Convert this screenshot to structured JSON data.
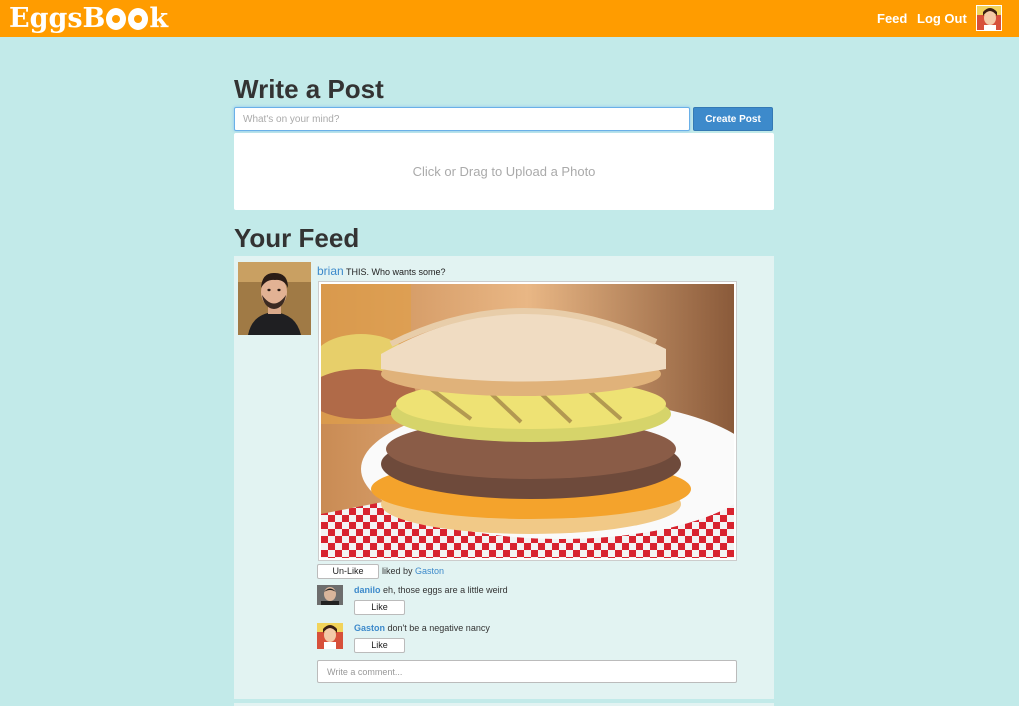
{
  "app": {
    "logo_text_before": "EggsB",
    "logo_text_after": "k"
  },
  "nav": {
    "feed_label": "Feed",
    "logout_label": "Log Out"
  },
  "compose": {
    "heading": "Write a Post",
    "placeholder": "What's on your mind?",
    "create_button": "Create Post",
    "upload_text": "Click or Drag to Upload a Photo"
  },
  "feed": {
    "heading": "Your Feed",
    "post": {
      "author": "brian",
      "text": "THIS. Who wants some?",
      "unlike_button": "Un-Like",
      "liked_by_prefix": "liked by",
      "liked_by_user": "Gaston",
      "comments": [
        {
          "user": "danilo",
          "text": "eh, those eggs are a little weird",
          "like_button": "Like"
        },
        {
          "user": "Gaston",
          "text": "don't be a negative nancy",
          "like_button": "Like"
        }
      ],
      "comment_placeholder": "Write a comment..."
    }
  },
  "colors": {
    "topbar": "#ff9c00",
    "background": "#c2eae9",
    "accent": "#3d8acb"
  }
}
